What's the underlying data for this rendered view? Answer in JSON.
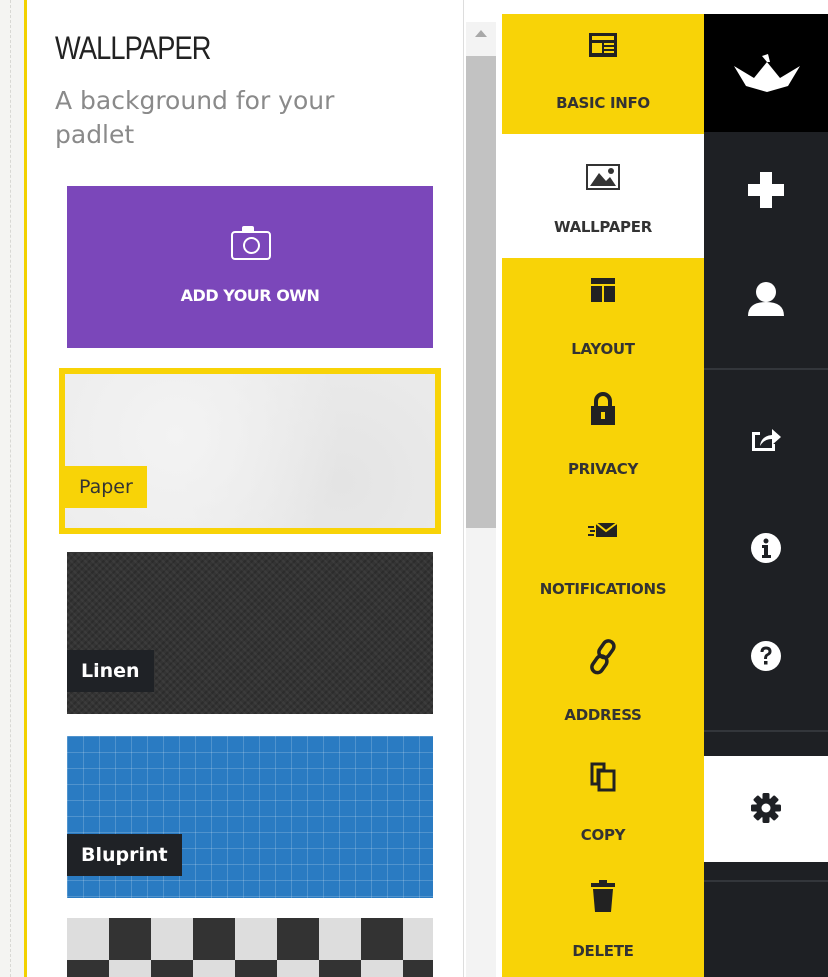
{
  "panel": {
    "title": "WALLPAPER",
    "subtitle": "A background for your padlet"
  },
  "wallpapers": {
    "add_own_label": "ADD YOUR OWN",
    "items": [
      {
        "label": "Paper",
        "selected": true
      },
      {
        "label": "Linen",
        "selected": false
      },
      {
        "label": "Bluprint",
        "selected": false
      }
    ]
  },
  "settings_menu": {
    "items": [
      {
        "label": "BASIC INFO",
        "icon": "newspaper-icon",
        "active": false
      },
      {
        "label": "WALLPAPER",
        "icon": "image-icon",
        "active": true
      },
      {
        "label": "LAYOUT",
        "icon": "layout-icon",
        "active": false
      },
      {
        "label": "PRIVACY",
        "icon": "lock-icon",
        "active": false
      },
      {
        "label": "NOTIFICATIONS",
        "icon": "envelope-icon",
        "active": false
      },
      {
        "label": "ADDRESS",
        "icon": "link-icon",
        "active": false
      },
      {
        "label": "COPY",
        "icon": "copy-icon",
        "active": false
      },
      {
        "label": "DELETE",
        "icon": "trash-icon",
        "active": false
      }
    ]
  },
  "rail": {
    "icons": [
      "crane-logo-icon",
      "plus-icon",
      "user-icon",
      "share-icon",
      "info-icon",
      "help-icon",
      "gear-icon"
    ],
    "active_icon": "gear-icon"
  },
  "colors": {
    "accent_yellow": "#f8d307",
    "add_tile_purple": "#7b47ba",
    "blueprint_blue": "#2a7bc2",
    "rail_dark": "#1e2024"
  }
}
